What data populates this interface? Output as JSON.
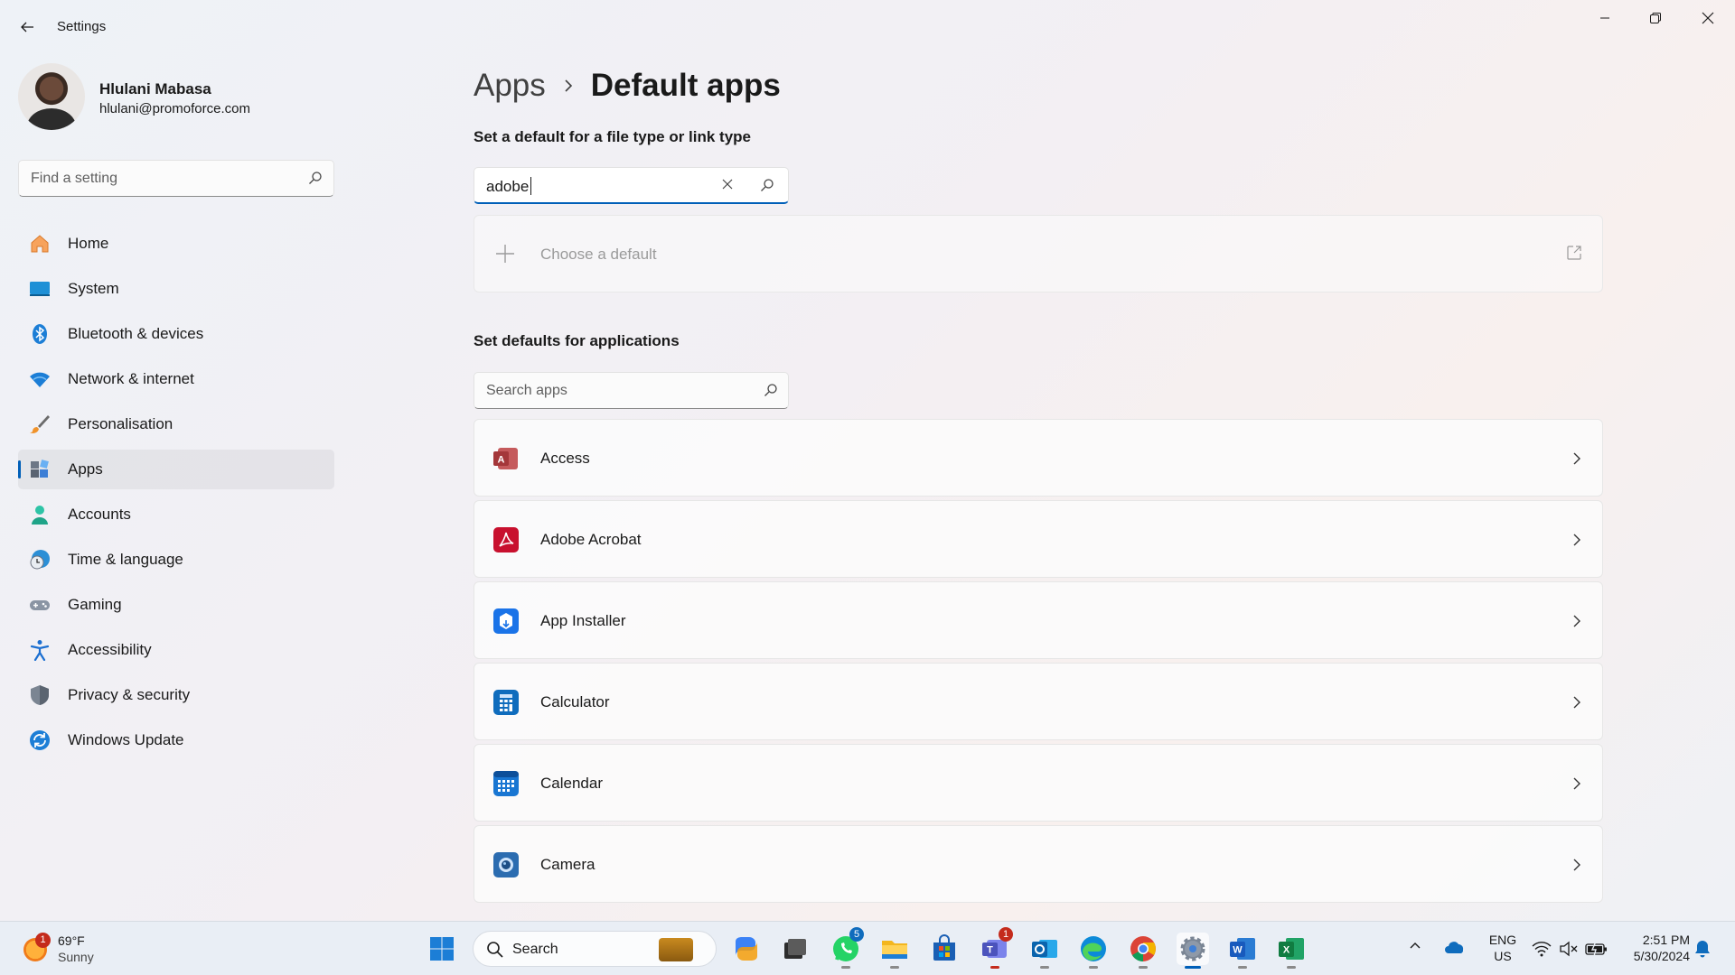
{
  "window": {
    "title": "Settings"
  },
  "profile": {
    "name": "Hlulani Mabasa",
    "email": "hlulani@promoforce.com"
  },
  "sidebar": {
    "search_placeholder": "Find a setting",
    "items": [
      {
        "label": "Home",
        "icon": "home-icon",
        "selected": false
      },
      {
        "label": "System",
        "icon": "system-icon",
        "selected": false
      },
      {
        "label": "Bluetooth & devices",
        "icon": "bluetooth-icon",
        "selected": false
      },
      {
        "label": "Network & internet",
        "icon": "wifi-icon",
        "selected": false
      },
      {
        "label": "Personalisation",
        "icon": "brush-icon",
        "selected": false
      },
      {
        "label": "Apps",
        "icon": "apps-icon",
        "selected": true
      },
      {
        "label": "Accounts",
        "icon": "accounts-icon",
        "selected": false
      },
      {
        "label": "Time & language",
        "icon": "time-language-icon",
        "selected": false
      },
      {
        "label": "Gaming",
        "icon": "gaming-icon",
        "selected": false
      },
      {
        "label": "Accessibility",
        "icon": "accessibility-icon",
        "selected": false
      },
      {
        "label": "Privacy & security",
        "icon": "shield-icon",
        "selected": false
      },
      {
        "label": "Windows Update",
        "icon": "windows-update-icon",
        "selected": false
      }
    ]
  },
  "breadcrumb": {
    "parent": "Apps",
    "current": "Default apps"
  },
  "filetype_section": {
    "title": "Set a default for a file type or link type",
    "search_value": "adobe",
    "choose_label": "Choose a default"
  },
  "apps_section": {
    "title": "Set defaults for applications",
    "search_placeholder": "Search apps",
    "apps": [
      {
        "label": "Access",
        "icon": "access-icon",
        "color": "#a4373a"
      },
      {
        "label": "Adobe Acrobat",
        "icon": "adobe-acrobat-icon",
        "color": "#c8102e"
      },
      {
        "label": "App Installer",
        "icon": "app-installer-icon",
        "color": "#1a73e8"
      },
      {
        "label": "Calculator",
        "icon": "calculator-icon",
        "color": "#0f6cbd"
      },
      {
        "label": "Calendar",
        "icon": "calendar-icon",
        "color": "#1976d2"
      },
      {
        "label": "Camera",
        "icon": "camera-icon",
        "color": "#2b6cb0"
      }
    ]
  },
  "taskbar": {
    "weather": {
      "temp": "69°F",
      "condition": "Sunny",
      "badge": "1"
    },
    "search_label": "Search",
    "whatsapp_badge": "5",
    "teams_badge": "1",
    "language": {
      "line1": "ENG",
      "line2": "US"
    },
    "clock": {
      "time": "2:51 PM",
      "date": "5/30/2024"
    }
  },
  "colors": {
    "accent": "#005fb8",
    "badge_red": "#c42b1c",
    "badge_blue": "#0f6cbd"
  }
}
